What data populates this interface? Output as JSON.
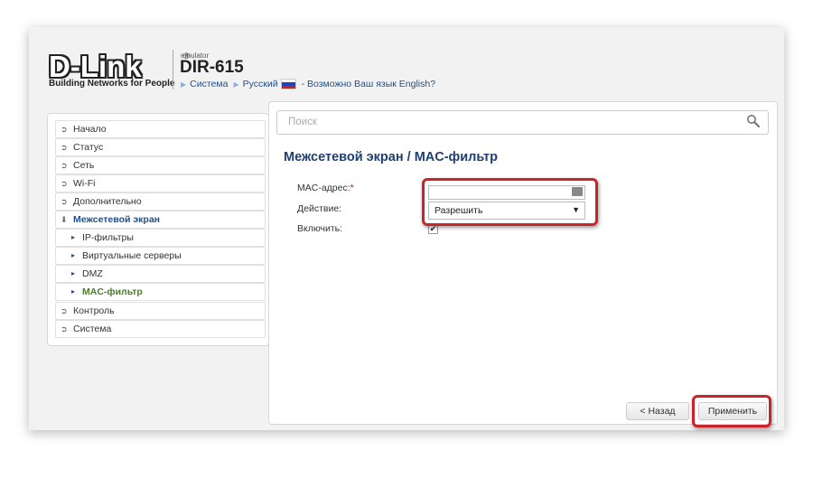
{
  "header": {
    "logo": "D-Link",
    "logo_reg": "®",
    "tagline": "Building Networks for People",
    "emulator": "emulator",
    "model": "DIR-615",
    "nav": {
      "system": "Система",
      "language": "Русский",
      "hint": "- Возможно Ваш язык English?"
    }
  },
  "colors": {
    "title_blue": "#1f3f70",
    "link_blue": "#1f4f8f",
    "current_green": "#4c7d2c",
    "highlight_red": "#c9242a"
  },
  "sidebar": {
    "items": [
      {
        "label": "Начало",
        "icon": "circle-arrow-icon"
      },
      {
        "label": "Статус",
        "icon": "circle-arrow-icon"
      },
      {
        "label": "Сеть",
        "icon": "circle-arrow-icon"
      },
      {
        "label": "Wi-Fi",
        "icon": "circle-arrow-icon"
      },
      {
        "label": "Дополнительно",
        "icon": "circle-arrow-icon"
      },
      {
        "label": "Межсетевой экран",
        "icon": "circle-arrow-down-icon"
      },
      {
        "label": "IP-фильтры",
        "icon": "chevron-right-icon"
      },
      {
        "label": "Виртуальные серверы",
        "icon": "chevron-right-icon"
      },
      {
        "label": "DMZ",
        "icon": "chevron-right-icon"
      },
      {
        "label": "MAC-фильтр",
        "icon": "chevron-right-icon"
      },
      {
        "label": "Контроль",
        "icon": "circle-arrow-icon"
      },
      {
        "label": "Система",
        "icon": "circle-arrow-icon"
      }
    ]
  },
  "search": {
    "placeholder": "Поиск"
  },
  "page": {
    "title": "Межсетевой экран /  MAC-фильтр",
    "form": {
      "mac_label": "MAC-адрес:",
      "mac_required": "*",
      "mac_value": "",
      "action_label": "Действие:",
      "action_value": "Разрешить",
      "enable_label": "Включить:",
      "enable_checked": true
    }
  },
  "buttons": {
    "back": "< Назад",
    "apply": "Применить"
  }
}
